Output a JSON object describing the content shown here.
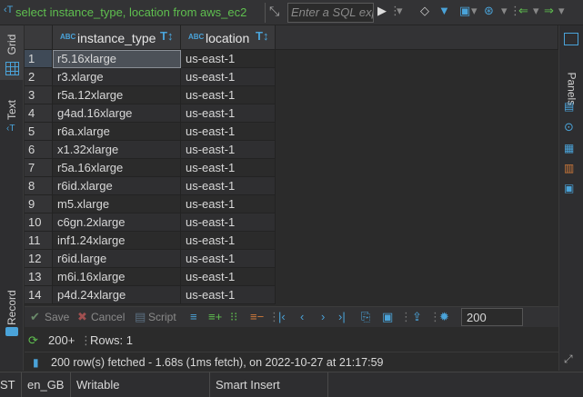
{
  "filter": {
    "query_text": "select instance_type, location from aws_ec2",
    "sql_placeholder": "Enter a SQL expression to filter results"
  },
  "left_tabs": {
    "grid": "Grid",
    "text": "Text",
    "record": "Record"
  },
  "right_tabs": {
    "panels": "Panels"
  },
  "columns": [
    {
      "type_badge": "ABC",
      "name": "instance_type"
    },
    {
      "type_badge": "ABC",
      "name": "location"
    }
  ],
  "rows": [
    {
      "n": "1",
      "instance_type": "r5.16xlarge",
      "location": "us-east-1"
    },
    {
      "n": "2",
      "instance_type": "r3.xlarge",
      "location": "us-east-1"
    },
    {
      "n": "3",
      "instance_type": "r5a.12xlarge",
      "location": "us-east-1"
    },
    {
      "n": "4",
      "instance_type": "g4ad.16xlarge",
      "location": "us-east-1"
    },
    {
      "n": "5",
      "instance_type": "r6a.xlarge",
      "location": "us-east-1"
    },
    {
      "n": "6",
      "instance_type": "x1.32xlarge",
      "location": "us-east-1"
    },
    {
      "n": "7",
      "instance_type": "r5a.16xlarge",
      "location": "us-east-1"
    },
    {
      "n": "8",
      "instance_type": "r6id.xlarge",
      "location": "us-east-1"
    },
    {
      "n": "9",
      "instance_type": "m5.xlarge",
      "location": "us-east-1"
    },
    {
      "n": "10",
      "instance_type": "c6gn.2xlarge",
      "location": "us-east-1"
    },
    {
      "n": "11",
      "instance_type": "inf1.24xlarge",
      "location": "us-east-1"
    },
    {
      "n": "12",
      "instance_type": "r6id.large",
      "location": "us-east-1"
    },
    {
      "n": "13",
      "instance_type": "m6i.16xlarge",
      "location": "us-east-1"
    },
    {
      "n": "14",
      "instance_type": "p4d.24xlarge",
      "location": "us-east-1"
    }
  ],
  "toolbar": {
    "save": "Save",
    "cancel": "Cancel",
    "script": "Script",
    "fetch_size": "200"
  },
  "status": {
    "row_count_badge": "200+",
    "rows": "Rows: 1",
    "fetch_message": "200 row(s) fetched - 1.68s (1ms fetch), on 2022-10-27 at 21:17:59"
  },
  "statusbar": {
    "mode": "ST",
    "locale": "en_GB",
    "writable": "Writable",
    "insert_mode": "Smart Insert"
  },
  "colors": {
    "accent": "#4aa3d9",
    "query_text": "#5fbf4f",
    "background": "#2b2b2b"
  }
}
